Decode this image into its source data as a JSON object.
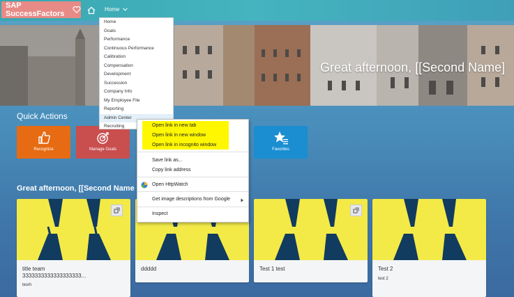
{
  "header": {
    "logo_text": "SAP SuccessFactors",
    "home_label": "Home",
    "logo_color": "#e88a86",
    "bar_color": "#45b4bf"
  },
  "nav_menu": {
    "items": [
      "Home",
      "Goals",
      "Performance",
      "Continuous Performance",
      "Calibration",
      "Compensation",
      "Development",
      "Succession",
      "Company Info",
      "My Employee File",
      "Reporting",
      "Admin Center",
      "Recruiting"
    ],
    "active": "Admin Center"
  },
  "hero": {
    "greeting": "Great afternoon, [[Second Name]"
  },
  "quick_actions": {
    "title": "Quick Actions",
    "tiles": [
      {
        "label": "Recognize",
        "icon": "thumbs-up-icon",
        "color": "#e66b12"
      },
      {
        "label": "Manage Goals",
        "icon": "target-icon",
        "color": "#c94e4e"
      },
      {
        "label": "Favorites",
        "icon": "star-list-icon",
        "color": "#1a8ed1"
      }
    ]
  },
  "section": {
    "title": "Great afternoon, [[Second Name"
  },
  "cards": [
    {
      "title_line1": "title team",
      "title_line2": "3333333333333333333...",
      "subtitle": "tesrh"
    },
    {
      "title_line1": "ddddd",
      "title_line2": "",
      "subtitle": ""
    },
    {
      "title_line1": "Test 1 test",
      "title_line2": "",
      "subtitle": ""
    },
    {
      "title_line1": "Test 2",
      "title_line2": "",
      "subtitle": "test 2"
    }
  ],
  "context_menu": {
    "items": {
      "open_new_tab": "Open link in new tab",
      "open_new_window": "Open link in new window",
      "open_incognito": "Open link in incognito window",
      "save_link": "Save link as...",
      "copy_link": "Copy link address",
      "httpwatch": "Open HttpWatch",
      "image_desc": "Get image descriptions from Google",
      "inspect": "Inspect"
    },
    "highlight_color": "#fff700"
  }
}
